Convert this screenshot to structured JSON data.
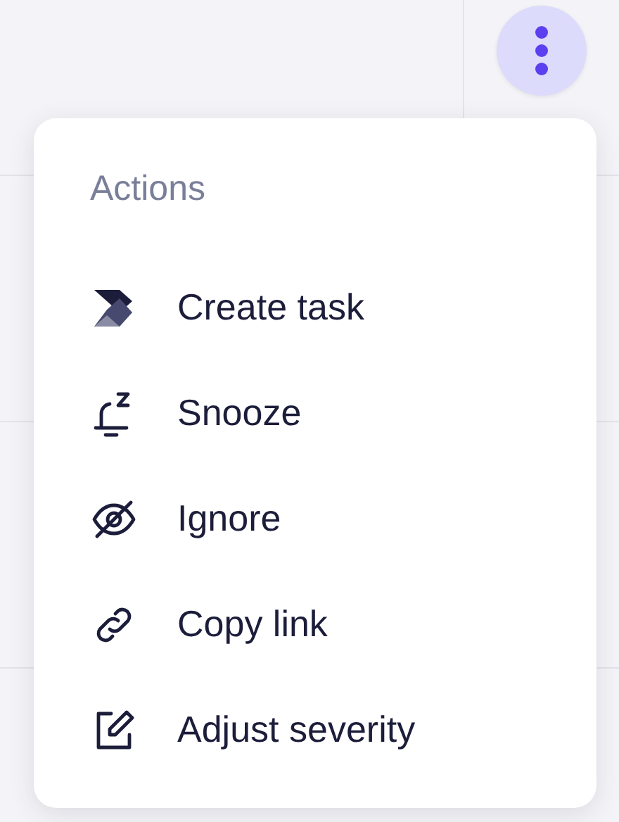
{
  "menu": {
    "heading": "Actions",
    "items": [
      {
        "kind": "task",
        "label": "Create task"
      },
      {
        "kind": "snooze",
        "label": "Snooze"
      },
      {
        "kind": "ignore",
        "label": "Ignore"
      },
      {
        "kind": "link",
        "label": "Copy link"
      },
      {
        "kind": "edit",
        "label": "Adjust severity"
      }
    ]
  }
}
